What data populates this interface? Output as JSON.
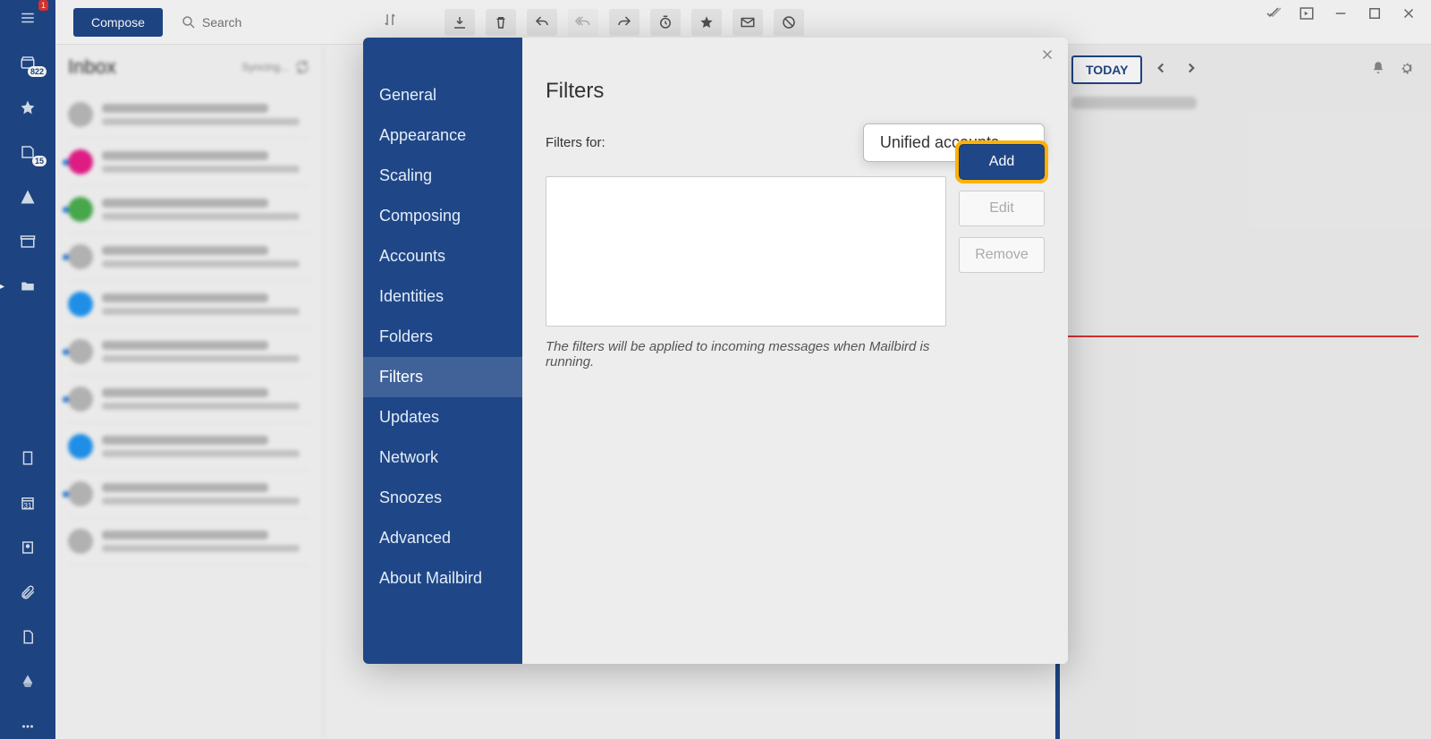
{
  "rail": {
    "menu_badge": "1",
    "inbox_count": "822",
    "drafts_count": "15"
  },
  "toolbar": {
    "compose": "Compose",
    "search_placeholder": "Search"
  },
  "inbox": {
    "title": "Inbox",
    "syncing": "Syncing..."
  },
  "calendar": {
    "today": "TODAY"
  },
  "settings": {
    "nav": {
      "general": "General",
      "appearance": "Appearance",
      "scaling": "Scaling",
      "composing": "Composing",
      "accounts": "Accounts",
      "identities": "Identities",
      "folders": "Folders",
      "filters": "Filters",
      "updates": "Updates",
      "network": "Network",
      "snoozes": "Snoozes",
      "advanced": "Advanced",
      "about": "About Mailbird"
    },
    "filters": {
      "title": "Filters",
      "filters_for_label": "Filters for:",
      "account_selected": "Unified accounts",
      "add": "Add",
      "edit": "Edit",
      "remove": "Remove",
      "hint": "The filters will be applied to incoming messages when Mailbird is running."
    }
  }
}
